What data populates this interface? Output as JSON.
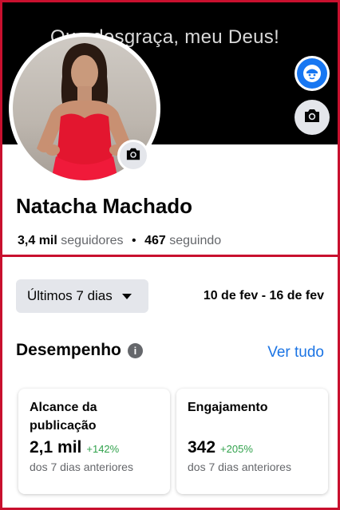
{
  "cover": {
    "text": "Que desgraça, meu Deus!"
  },
  "profile": {
    "name": "Natacha Machado",
    "followers_count": "3,4 mil",
    "followers_label": "seguidores",
    "separator": "•",
    "following_count": "467",
    "following_label": "seguindo"
  },
  "filter": {
    "range_label": "Últimos 7 dias",
    "date_range": "10 de fev - 16 de fev"
  },
  "performance": {
    "title": "Desempenho",
    "see_all": "Ver tudo",
    "cards": [
      {
        "title": "Alcance da publicação",
        "value": "2,1 mil",
        "change": "+142%",
        "subtitle": "dos 7 dias anteriores"
      },
      {
        "title": "Engajamento",
        "value": "342",
        "change": "+205%",
        "subtitle": "dos 7 dias anteriores"
      }
    ]
  },
  "colors": {
    "accent_blue": "#1877f2",
    "link_blue": "#1b74e4",
    "positive_green": "#31a24c",
    "frame_red": "#c8102e"
  },
  "icons": [
    "camera-icon",
    "avatar-icon",
    "caret-down-icon",
    "info-icon"
  ]
}
